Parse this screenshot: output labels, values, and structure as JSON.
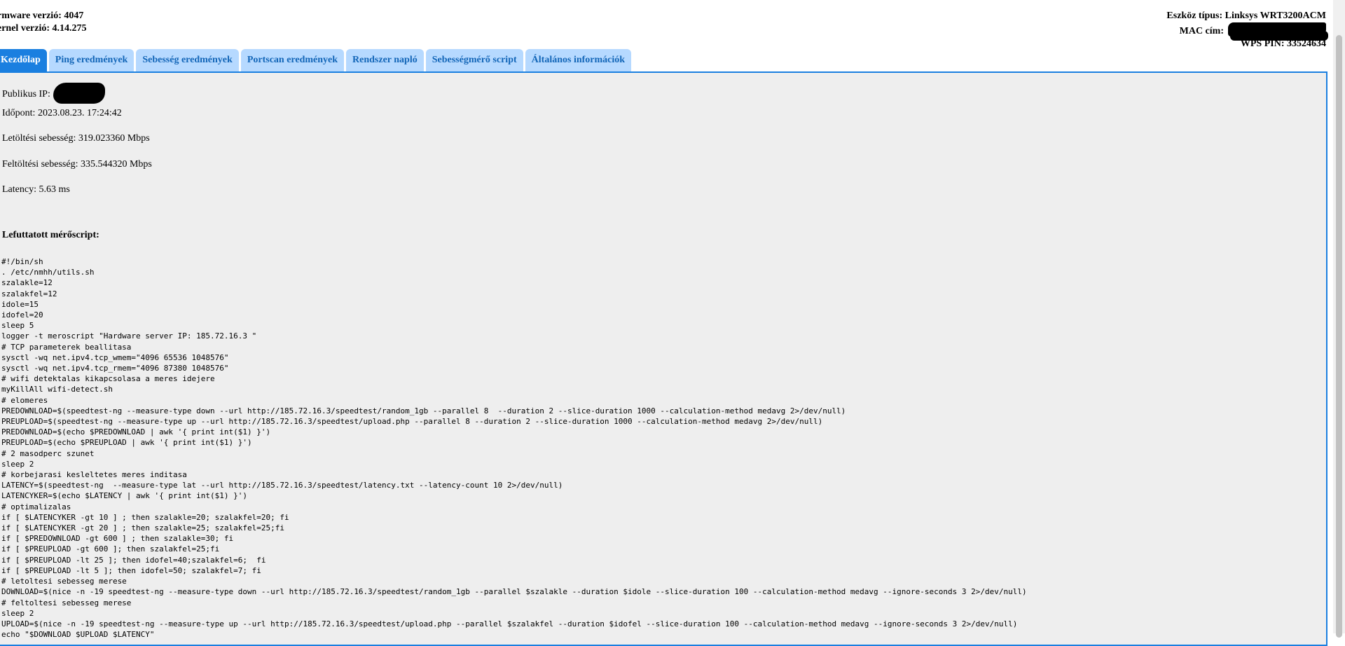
{
  "header": {
    "firmware": "rmware verzió: 4047",
    "kernel": "ernel verzió: 4.14.275",
    "device_type": "Eszköz típus: Linksys WRT3200ACM",
    "mac_label": "MAC cím:",
    "wps_pin": "WPS PIN: 33524634"
  },
  "tabs": [
    {
      "label": "Kezdőlap",
      "active": true
    },
    {
      "label": "Ping eredmények"
    },
    {
      "label": "Sebesség eredmények"
    },
    {
      "label": "Portscan eredmények"
    },
    {
      "label": "Rendszer napló"
    },
    {
      "label": "Sebességmérő script"
    },
    {
      "label": "Általános információk"
    }
  ],
  "info": {
    "public_ip": "Publikus IP: 1",
    "time": "Időpont: 2023.08.23. 17:24:42",
    "download": "Letöltési sebesség: 319.023360 Mbps",
    "upload": "Feltöltési sebesség: 335.544320 Mbps",
    "latency": "Latency: 5.63 ms"
  },
  "script_title": "Lefuttatott mérőscript:",
  "script": "#!/bin/sh\n. /etc/nmhh/utils.sh\nszalakle=12\nszalakfel=12\nidole=15\nidofel=20\nsleep 5\nlogger -t meroscript \"Hardware server IP: 185.72.16.3 \"\n# TCP parameterek beallitasa\nsysctl -wq net.ipv4.tcp_wmem=\"4096 65536 1048576\"\nsysctl -wq net.ipv4.tcp_rmem=\"4096 87380 1048576\"\n# wifi detektalas kikapcsolasa a meres idejere\nmyKillAll wifi-detect.sh\n# elomeres\nPREDOWNLOAD=$(speedtest-ng --measure-type down --url http://185.72.16.3/speedtest/random_1gb --parallel 8  --duration 2 --slice-duration 1000 --calculation-method medavg 2>/dev/null)\nPREUPLOAD=$(speedtest-ng --measure-type up --url http://185.72.16.3/speedtest/upload.php --parallel 8 --duration 2 --slice-duration 1000 --calculation-method medavg 2>/dev/null)\nPREDOWNLOAD=$(echo $PREDOWNLOAD | awk '{ print int($1) }')\nPREUPLOAD=$(echo $PREUPLOAD | awk '{ print int($1) }')\n# 2 masodperc szunet\nsleep 2\n# korbejarasi kesleltetes meres inditasa\nLATENCY=$(speedtest-ng  --measure-type lat --url http://185.72.16.3/speedtest/latency.txt --latency-count 10 2>/dev/null)\nLATENCYKER=$(echo $LATENCY | awk '{ print int($1) }')\n# optimalizalas\nif [ $LATENCYKER -gt 10 ] ; then szalakle=20; szalakfel=20; fi\nif [ $LATENCYKER -gt 20 ] ; then szalakle=25; szalakfel=25;fi\nif [ $PREDOWNLOAD -gt 600 ] ; then szalakle=30; fi\nif [ $PREUPLOAD -gt 600 ]; then szalakfel=25;fi\nif [ $PREUPLOAD -lt 25 ]; then idofel=40;szalakfel=6;  fi\nif [ $PREUPLOAD -lt 5 ]; then idofel=50; szalakfel=7; fi\n# letoltesi sebesseg merese\nDOWNLOAD=$(nice -n -19 speedtest-ng --measure-type down --url http://185.72.16.3/speedtest/random_1gb --parallel $szalakle --duration $idole --slice-duration 100 --calculation-method medavg --ignore-seconds 3 2>/dev/null)\n# feltoltesi sebesseg merese\nsleep 2\nUPLOAD=$(nice -n -19 speedtest-ng --measure-type up --url http://185.72.16.3/speedtest/upload.php --parallel $szalakfel --duration $idofel --slice-duration 100 --calculation-method medavg --ignore-seconds 3 2>/dev/null)\necho \"$DOWNLOAD $UPLOAD $LATENCY\""
}
